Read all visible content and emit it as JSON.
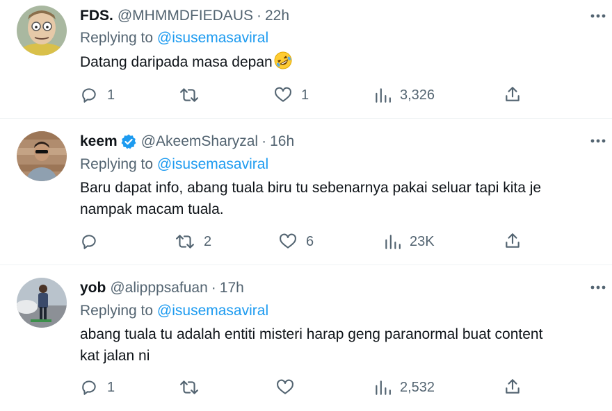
{
  "tweets": [
    {
      "name": "FDS.",
      "handle": "@MHMMDFIEDAUS",
      "dot": "·",
      "time": "22h",
      "verified": false,
      "replying_prefix": "Replying to ",
      "replying_to": "@isusemasaviral",
      "text": "Datang daripada masa depan",
      "emoji": "rolling-on-floor-laughing",
      "replies": "1",
      "retweets": "",
      "likes": "1",
      "views": "3,326"
    },
    {
      "name": "keem",
      "handle": "@AkeemSharyzal",
      "dot": "·",
      "time": "16h",
      "verified": true,
      "replying_prefix": "Replying to ",
      "replying_to": "@isusemasaviral",
      "text_line1": "Baru dapat info, abang tuala biru tu sebenarnya pakai seluar tapi kita je",
      "text_line2": "nampak macam tuala.",
      "replies": "",
      "retweets": "2",
      "likes": "6",
      "views": "23K"
    },
    {
      "name": "yob",
      "handle": "@alipppsafuan",
      "dot": "·",
      "time": "17h",
      "verified": false,
      "replying_prefix": "Replying to ",
      "replying_to": "@isusemasaviral",
      "text_line1": "abang tuala tu adalah entiti misteri harap geng paranormal buat content",
      "text_line2": "kat jalan ni",
      "replies": "1",
      "retweets": "",
      "likes": "",
      "views": "2,532"
    }
  ],
  "colors": {
    "text": "#0f1419",
    "secondary": "#536471",
    "link": "#1d9bf0",
    "divider": "#eff3f4"
  },
  "icons": [
    "reply-icon",
    "retweet-icon",
    "like-icon",
    "views-icon",
    "share-icon",
    "more-icon",
    "verified-icon"
  ]
}
